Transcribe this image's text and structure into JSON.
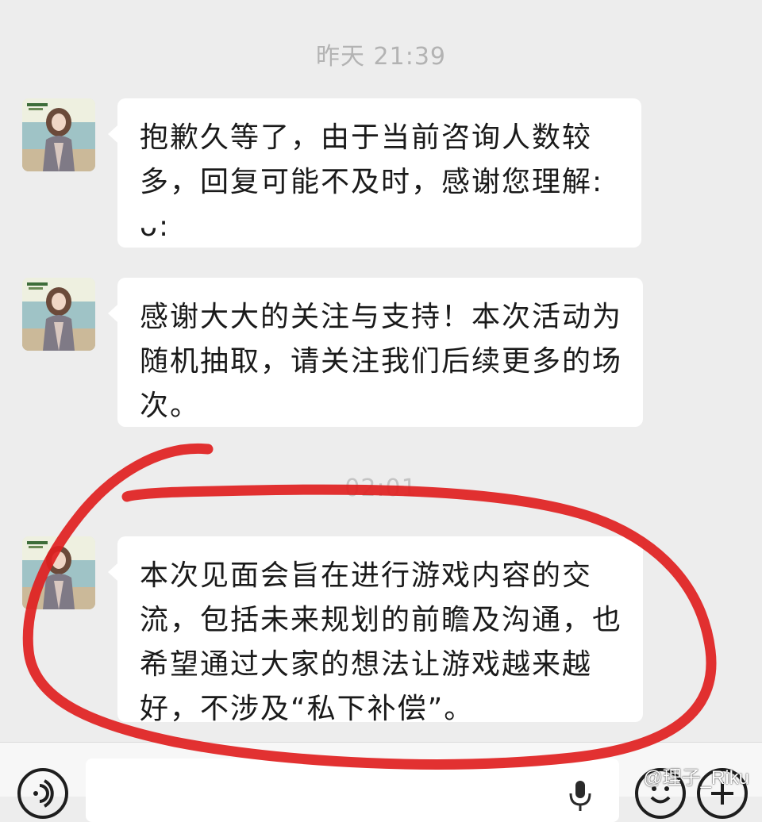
{
  "chat": {
    "timestamps": [
      "昨天 21:39",
      "02:01"
    ],
    "messages": [
      {
        "text": "抱歉久等了，由于当前咨询人数较多，回复可能不及时，感谢您理解:ᴗ:"
      },
      {
        "text": "感谢大大的关注与支持！本次活动为随机抽取，请关注我们后续更多的场次。"
      },
      {
        "text": "本次见面会旨在进行游戏内容的交流，包括未来规划的前瞻及沟通，也希望通过大家的想法让游戏越来越好，不涉及“私下补偿”。"
      }
    ]
  },
  "input_bar": {
    "voice_icon": "voice-icon",
    "mic_icon": "mic-icon",
    "emoji_icon": "emoji-icon",
    "plus_icon": "plus-icon"
  },
  "watermark": {
    "text": "@理子_Riku"
  },
  "colors": {
    "chat_background": "#ededed",
    "bubble": "#ffffff",
    "annotation_stroke": "#e02020"
  }
}
